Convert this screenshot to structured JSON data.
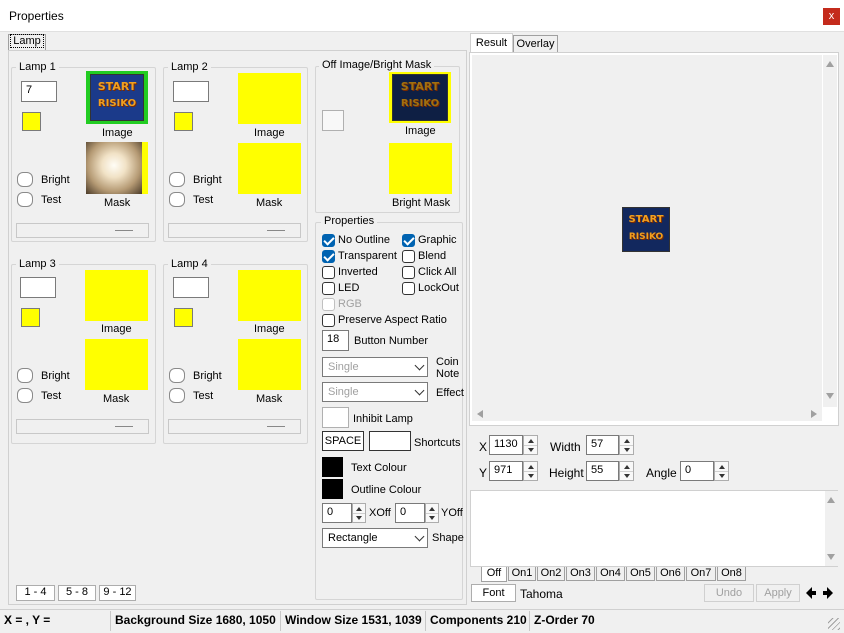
{
  "window": {
    "title": "Properties",
    "close_glyph": "x"
  },
  "left_tab": "Lamp",
  "lamps": [
    {
      "title": "Lamp 1",
      "number": "7",
      "image_label": "Image",
      "mask_label": "Mask",
      "bright_label": "Bright",
      "test_label": "Test"
    },
    {
      "title": "Lamp 2",
      "number": "",
      "image_label": "Image",
      "mask_label": "Mask",
      "bright_label": "Bright",
      "test_label": "Test"
    },
    {
      "title": "Lamp 3",
      "number": "",
      "image_label": "Image",
      "mask_label": "Mask",
      "bright_label": "Bright",
      "test_label": "Test"
    },
    {
      "title": "Lamp 4",
      "number": "",
      "image_label": "Image",
      "mask_label": "Mask",
      "bright_label": "Bright",
      "test_label": "Test"
    }
  ],
  "art_text": {
    "line1": "START",
    "line2": "RISIKO"
  },
  "off_image": {
    "title": "Off Image/Bright Mask",
    "image_label": "Image",
    "bright_mask_label": "Bright Mask"
  },
  "properties": {
    "title": "Properties",
    "no_outline": "No Outline",
    "graphic": "Graphic",
    "transparent": "Transparent",
    "blend": "Blend",
    "inverted": "Inverted",
    "click_all": "Click All",
    "led": "LED",
    "lockout": "LockOut",
    "rgb": "RGB",
    "preserve_aspect": "Preserve Aspect Ratio",
    "button_number_value": "18",
    "button_number_label": "Button Number",
    "coin_note_value": "Single",
    "coin_note_label_1": "Coin",
    "coin_note_label_2": "Note",
    "effect_value": "Single",
    "effect_label": "Effect",
    "inhibit_lamp_label": "Inhibit Lamp",
    "shortcut_value": "SPACE",
    "shortcuts_label": "Shortcuts",
    "text_colour_label": "Text Colour",
    "outline_colour_label": "Outline Colour",
    "xoff_value": "0",
    "xoff_label": "XOff",
    "yoff_value": "0",
    "yoff_label": "YOff",
    "shape_value": "Rectangle",
    "shape_label": "Shape"
  },
  "lamp_pages": [
    "1 - 4",
    "5 - 8",
    "9 - 12"
  ],
  "right_tabs": [
    "Result",
    "Overlay"
  ],
  "position": {
    "x_label": "X",
    "x_value": "1130",
    "y_label": "Y",
    "y_value": "971",
    "width_label": "Width",
    "width_value": "57",
    "height_label": "Height",
    "height_value": "55",
    "angle_label": "Angle",
    "angle_value": "0"
  },
  "state_tabs": [
    "Off",
    "On1",
    "On2",
    "On3",
    "On4",
    "On5",
    "On6",
    "On7",
    "On8"
  ],
  "font": {
    "button_label": "Font",
    "name": "Tahoma"
  },
  "actions": {
    "undo": "Undo",
    "apply": "Apply"
  },
  "status": {
    "coords": "X =  , Y =",
    "background": "Background Size 1680, 1050",
    "window_size": "Window Size 1531, 1039",
    "components": "Components 210",
    "zorder": "Z-Order 70"
  },
  "colors": {
    "lamp_yellow": "#ffff00",
    "check_blue": "#0063b1",
    "close_red": "#c42b1c"
  }
}
